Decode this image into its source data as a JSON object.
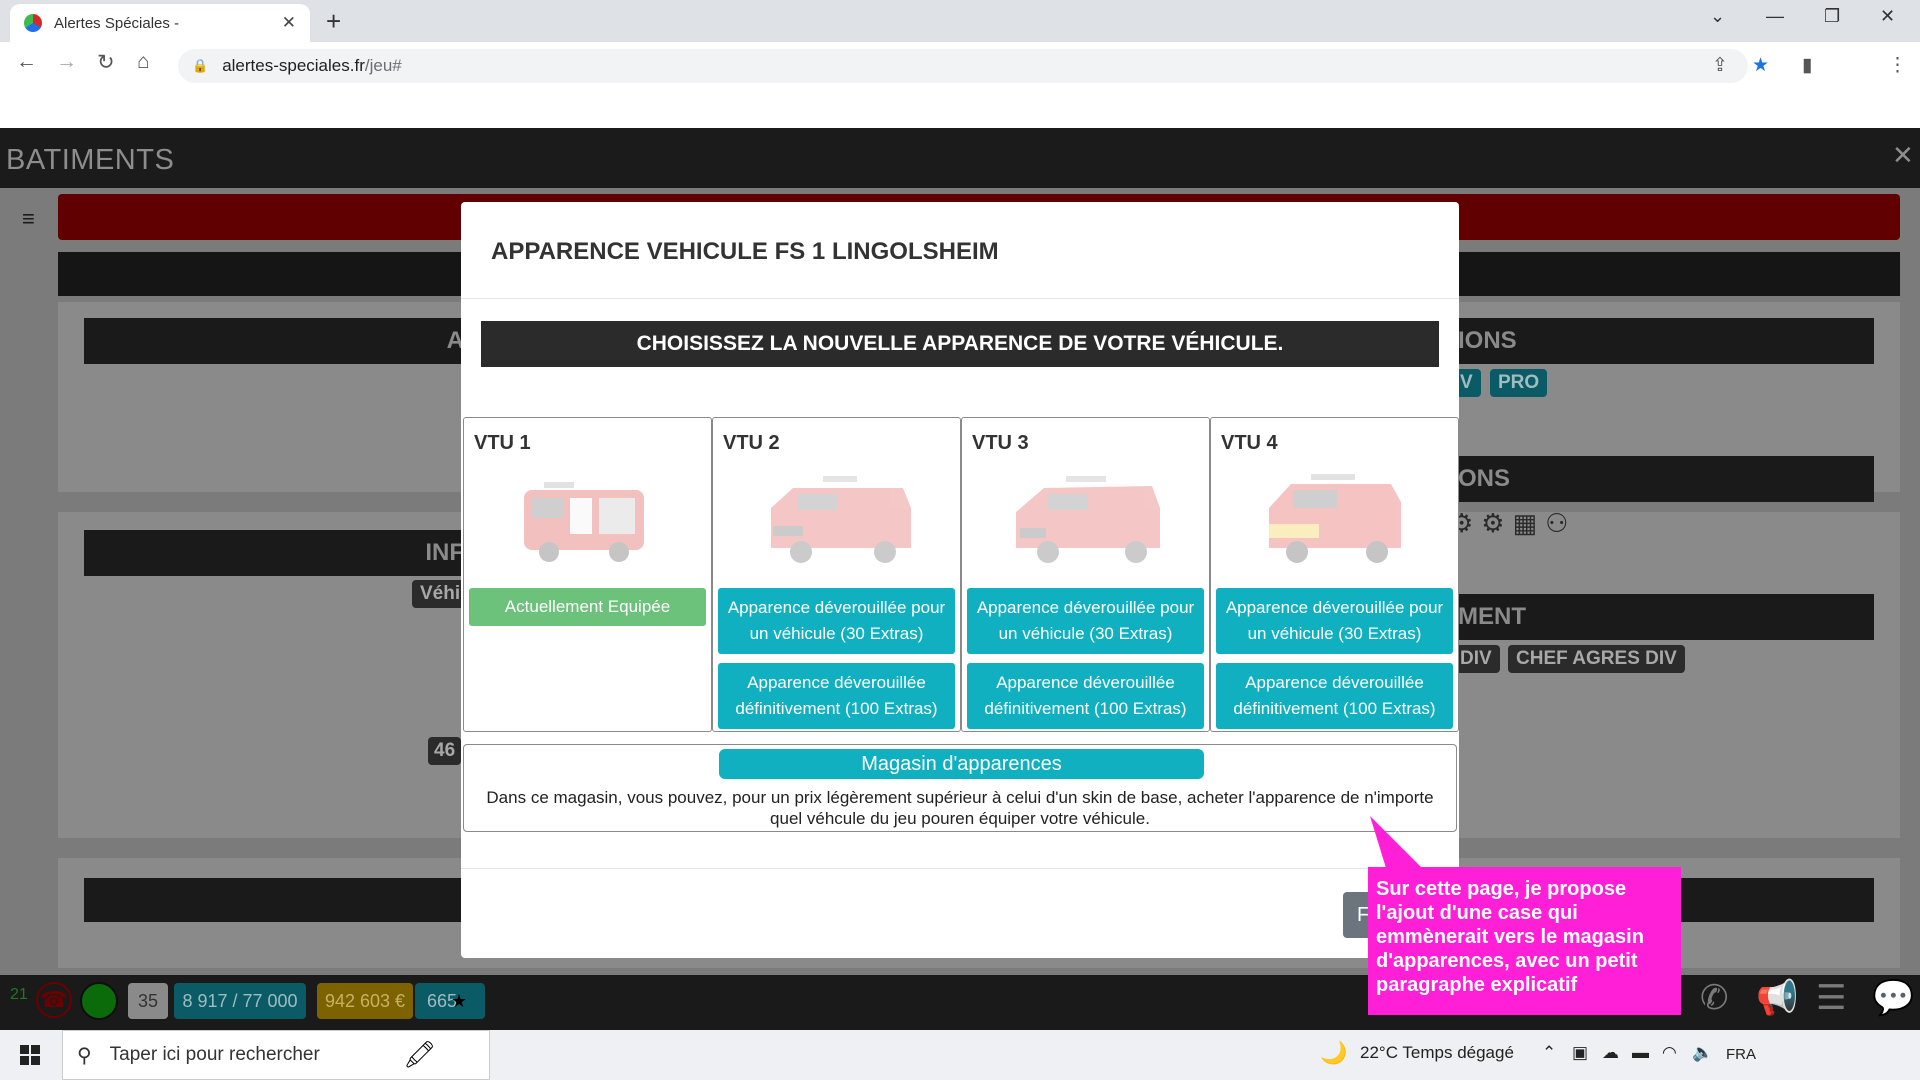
{
  "browser": {
    "tab_title": "Alertes Spéciales -",
    "url_domain": "alertes-speciales.fr",
    "url_path": "/jeu#"
  },
  "page": {
    "section_title": "BATIMENTS",
    "strip_texts": [
      "A",
      "IONS",
      "INF",
      "ONS",
      "MENT"
    ],
    "chips": [
      "Véhi",
      "V",
      "PRO",
      "DIV",
      "CHEF AGRES DIV",
      "46"
    ]
  },
  "modal": {
    "title": "APPARENCE VEHICULE FS 1 LINGOLSHEIM",
    "subtitle": "CHOISISSEZ LA NOUVELLE APPARENCE DE VOTRE VÉHICULE.",
    "cards": [
      {
        "name": "VTU 1",
        "buttons": [
          "Actuellement Equipée"
        ]
      },
      {
        "name": "VTU 2",
        "buttons": [
          "Apparence déverouillée pour un véhicule (30 Extras)",
          "Apparence déverouillée définitivement (100 Extras)"
        ]
      },
      {
        "name": "VTU 3",
        "buttons": [
          "Apparence déverouillée pour un véhicule (30 Extras)",
          "Apparence déverouillée définitivement (100 Extras)"
        ]
      },
      {
        "name": "VTU 4",
        "buttons": [
          "Apparence déverouillée pour un véhicule (30 Extras)",
          "Apparence déverouillée définitivement (100 Extras)"
        ]
      }
    ],
    "shop_button": "Magasin d'apparences",
    "shop_description": "Dans ce magasin, vous pouvez, pour un prix légèrement supérieur à celui d'un skin de base, acheter l'apparence de n'importe quel véhcule du jeu pouren équiper votre véhicule.",
    "footer_button": "F"
  },
  "callout": {
    "text": "Sur cette page, je propose l'ajout d'une case qui emmènerait vers le magasin d'apparences, avec un petit paragraphe explicatif",
    "color": "#ff1fd6"
  },
  "gamebar": {
    "calls_count": "21",
    "count_badge": "35",
    "capacity": "8 917 / 77 000",
    "money": "942 603 €",
    "stars": "665"
  },
  "taskbar": {
    "search_placeholder": "Taper ici pour rechercher",
    "weather": "22°C  Temps dégagé",
    "language": "FRA"
  }
}
